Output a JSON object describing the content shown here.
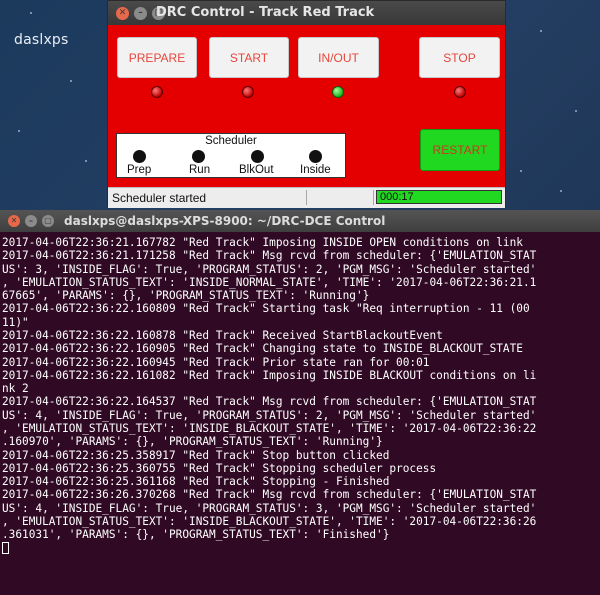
{
  "desktop": {
    "label": "daslxps"
  },
  "drc_window": {
    "title": "DRC Control - Track Red Track",
    "buttons": {
      "prepare": "PREPARE",
      "start": "START",
      "in_out": "IN/OUT",
      "stop": "STOP",
      "restart": "RESTART"
    },
    "leds": {
      "prepare": "red",
      "start": "red",
      "in_out": "green",
      "stop": "red"
    },
    "scheduler": {
      "title": "Scheduler",
      "states": [
        "Prep",
        "Run",
        "BlkOut",
        "Inside"
      ]
    },
    "status": {
      "text": "Scheduler started",
      "timer": "000:17"
    }
  },
  "terminal": {
    "title": "daslxps@daslxps-XPS-8900: ~/DRC-DCE Control",
    "lines": [
      "2017-04-06T22:36:21.167782 \"Red Track\" Imposing INSIDE OPEN conditions on link",
      "2017-04-06T22:36:21.171258 \"Red Track\" Msg rcvd from scheduler: {'EMULATION_STAT",
      "US': 3, 'INSIDE_FLAG': True, 'PROGRAM_STATUS': 2, 'PGM_MSG': 'Scheduler started'",
      ", 'EMULATION_STATUS_TEXT': 'INSIDE_NORMAL_STATE', 'TIME': '2017-04-06T22:36:21.1",
      "67665', 'PARAMS': {}, 'PROGRAM_STATUS_TEXT': 'Running'}",
      "2017-04-06T22:36:22.160809 \"Red Track\" Starting task \"Req interruption - 11 (00",
      "11)\"",
      "2017-04-06T22:36:22.160878 \"Red Track\" Received StartBlackoutEvent",
      "2017-04-06T22:36:22.160905 \"Red Track\" Changing state to INSIDE_BLACKOUT_STATE",
      "2017-04-06T22:36:22.160945 \"Red Track\" Prior state ran for 00:01",
      "2017-04-06T22:36:22.161082 \"Red Track\" Imposing INSIDE BLACKOUT conditions on li",
      "nk 2",
      "2017-04-06T22:36:22.164537 \"Red Track\" Msg rcvd from scheduler: {'EMULATION_STAT",
      "US': 4, 'INSIDE_FLAG': True, 'PROGRAM_STATUS': 2, 'PGM_MSG': 'Scheduler started'",
      ", 'EMULATION_STATUS_TEXT': 'INSIDE_BLACKOUT_STATE', 'TIME': '2017-04-06T22:36:22",
      ".160970', 'PARAMS': {}, 'PROGRAM_STATUS_TEXT': 'Running'}",
      "2017-04-06T22:36:25.358917 \"Red Track\" Stop button clicked",
      "2017-04-06T22:36:25.360755 \"Red Track\" Stopping scheduler process",
      "2017-04-06T22:36:25.361168 \"Red Track\" Stopping - Finished",
      "2017-04-06T22:36:26.370268 \"Red Track\" Msg rcvd from scheduler: {'EMULATION_STAT",
      "US': 4, 'INSIDE_FLAG': True, 'PROGRAM_STATUS': 3, 'PGM_MSG': 'Scheduler started'",
      ", 'EMULATION_STATUS_TEXT': 'INSIDE_BLACKOUT_STATE', 'TIME': '2017-04-06T22:36:26",
      ".361031', 'PARAMS': {}, 'PROGRAM_STATUS_TEXT': 'Finished'}"
    ]
  },
  "colors": {
    "window_bg": "#e40000",
    "button_text": "#e6463c",
    "restart_bg": "#1fd81f",
    "terminal_bg": "#300a24",
    "led_red": "#c00000",
    "led_green": "#17b51a"
  }
}
